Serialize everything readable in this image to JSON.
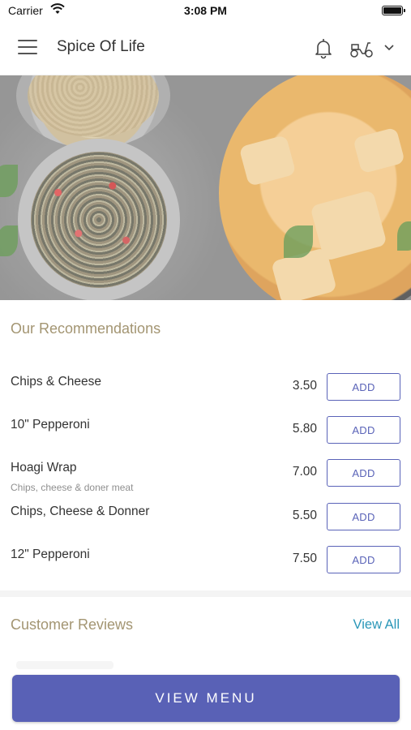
{
  "status_bar": {
    "carrier": "Carrier",
    "time": "3:08 PM"
  },
  "header": {
    "title": "Spice Of Life",
    "icons": [
      "hamburger-menu-icon",
      "bell-icon",
      "scooter-icon",
      "chevron-down-icon"
    ]
  },
  "recommendations": {
    "title": "Our Recommendations",
    "add_label": "ADD",
    "items": [
      {
        "name": "Chips & Cheese",
        "price": "3.50",
        "desc": ""
      },
      {
        "name": "10\" Pepperoni",
        "price": "5.80",
        "desc": ""
      },
      {
        "name": "Hoagi Wrap",
        "price": "7.00",
        "desc": "Chips, cheese & doner meat"
      },
      {
        "name": "Chips, Cheese & Donner",
        "price": "5.50",
        "desc": ""
      },
      {
        "name": "12\" Pepperoni",
        "price": "7.50",
        "desc": ""
      }
    ]
  },
  "reviews": {
    "title": "Customer Reviews",
    "view_all": "View All"
  },
  "footer": {
    "view_menu_label": "VIEW MENU"
  },
  "colors": {
    "accent": "#5961b6",
    "section_title": "#a39572",
    "link": "#2b97b8"
  }
}
